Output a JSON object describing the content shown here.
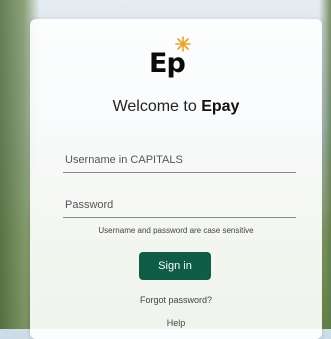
{
  "brand": {
    "logo_text": "Ep",
    "star_icon": "sun-star-icon",
    "accent_color": "#f0a11a"
  },
  "welcome": {
    "prefix": "Welcome to ",
    "brand_name": "Epay"
  },
  "form": {
    "username_placeholder": "Username in CAPITALS",
    "password_placeholder": "Password",
    "hint": "Username and password are case sensitive",
    "signin_label": "Sign in",
    "signin_color": "#0e5d44"
  },
  "links": {
    "forgot_password": "Forgot password?",
    "help": "Help"
  }
}
